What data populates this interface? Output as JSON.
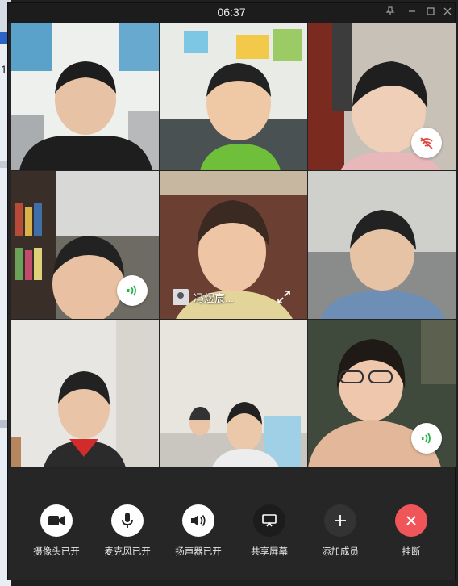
{
  "window": {
    "clock": "06:37"
  },
  "desktop": {
    "partial_text": "1"
  },
  "participants": [
    {
      "id": "p1",
      "name": null
    },
    {
      "id": "p2",
      "name": null
    },
    {
      "id": "p3",
      "name": null,
      "status_icon": "speaker-muted-icon"
    },
    {
      "id": "p4",
      "name": null,
      "status_icon": "speaking-icon"
    },
    {
      "id": "p5",
      "name": "冯煜宸...",
      "focused": true
    },
    {
      "id": "p6",
      "name": null
    },
    {
      "id": "p7",
      "name": null
    },
    {
      "id": "p8",
      "name": null
    },
    {
      "id": "p9",
      "name": null,
      "status_icon": "speaking-icon"
    }
  ],
  "toolbar": {
    "camera": "摄像头已开",
    "mic": "麦克风已开",
    "speaker": "扬声器已开",
    "share": "共享屏幕",
    "add": "添加成员",
    "hangup": "挂断"
  },
  "colors": {
    "hangup": "#f0555a",
    "speaking": "#2bb34a",
    "muted": "#e0453f",
    "button_bg": "#ffffff"
  }
}
